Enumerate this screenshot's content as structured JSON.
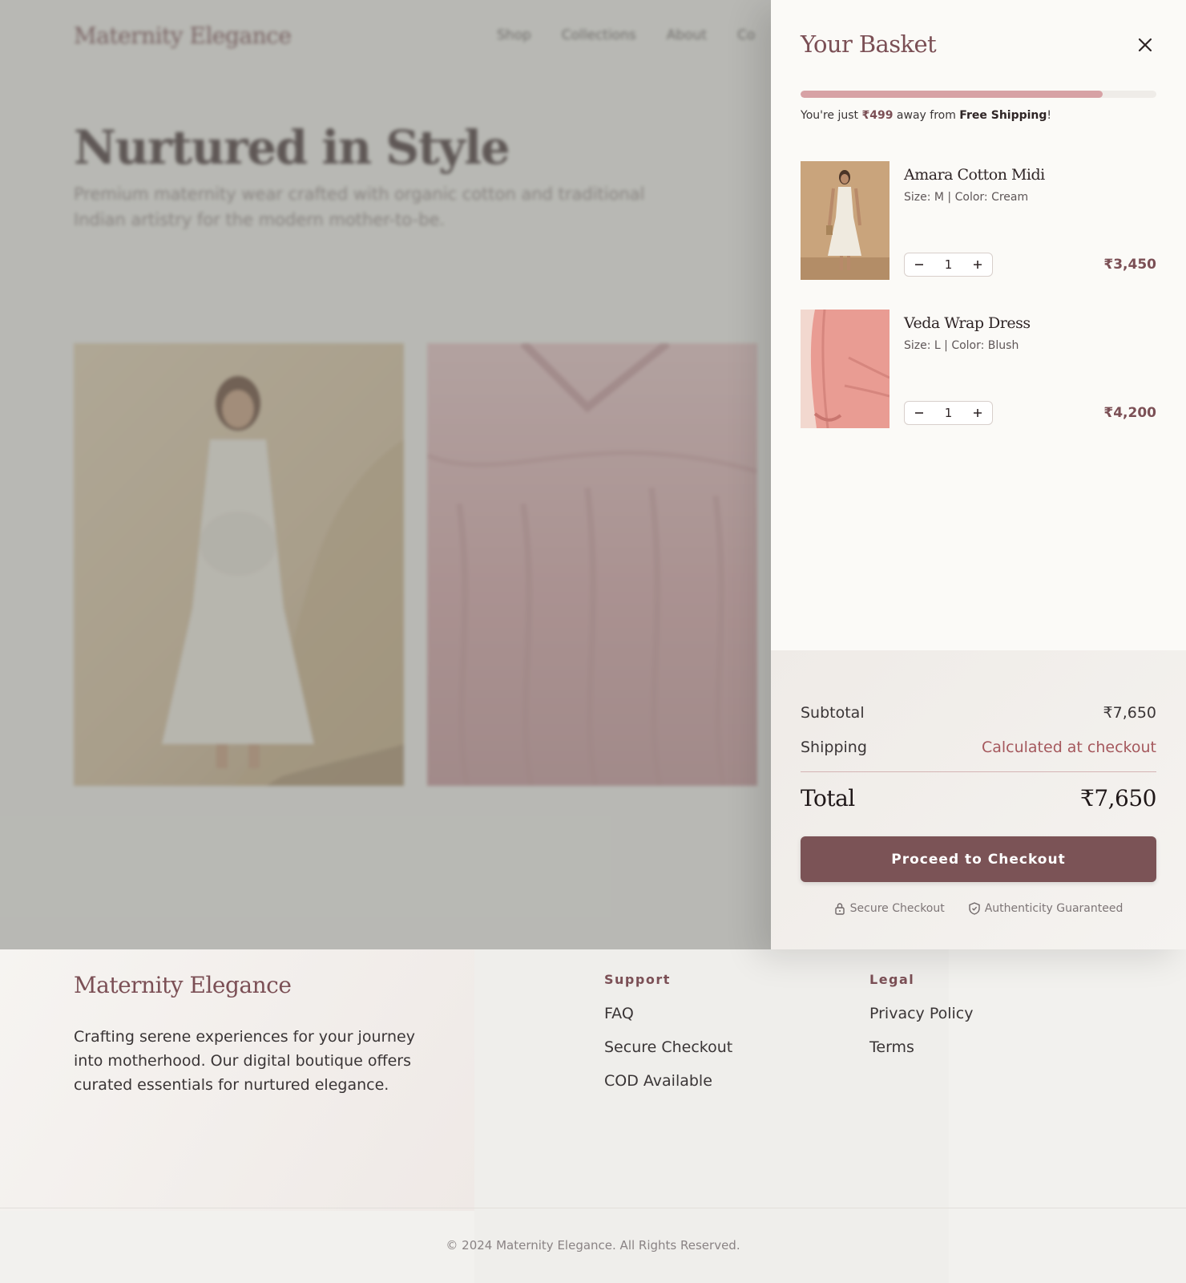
{
  "site": {
    "logo": "Maternity Elegance",
    "nav": [
      "Shop",
      "Collections",
      "About",
      "Co"
    ],
    "hero_title": "Nurtured in Style",
    "hero_subtitle": "Premium maternity wear crafted with organic cotton and traditional Indian artistry for the modern mother-to-be."
  },
  "drawer": {
    "title": "Your Basket",
    "close_icon": "close-icon",
    "shipping_progress": 0.85,
    "shipping_msg": {
      "prefix": "You're just ",
      "amount": "₹499",
      "middle": " away from ",
      "bold": "Free Shipping",
      "suffix": "!"
    },
    "items": [
      {
        "name": "Amara Cotton Midi",
        "meta": "Size: M | Color: Cream",
        "qty": "1",
        "price": "₹3,450"
      },
      {
        "name": "Veda Wrap Dress",
        "meta": "Size: L | Color: Blush",
        "qty": "1",
        "price": "₹4,200"
      }
    ],
    "summary": {
      "subtotal_label": "Subtotal",
      "subtotal_value": "₹7,650",
      "shipping_label": "Shipping",
      "shipping_value": "Calculated at checkout",
      "total_label": "Total",
      "total_value": "₹7,650",
      "checkout_label": "Proceed to Checkout",
      "trust_secure": "Secure Checkout",
      "trust_auth": "Authenticity Guaranteed"
    }
  },
  "footer": {
    "brand": "Maternity Elegance",
    "description": "Crafting serene experiences for your journey into motherhood. Our digital boutique offers curated essentials for nurtured elegance.",
    "support_heading": "Support",
    "support_links": [
      "FAQ",
      "Secure Checkout",
      "COD Available"
    ],
    "legal_heading": "Legal",
    "legal_links": [
      "Privacy Policy",
      "Terms"
    ],
    "copyright": "© 2024 Maternity Elegance. All Rights Reserved."
  },
  "colors": {
    "brand": "#7b4f55",
    "accent_pink": "#d7a2a5",
    "checkout_button": "#7b5356"
  }
}
